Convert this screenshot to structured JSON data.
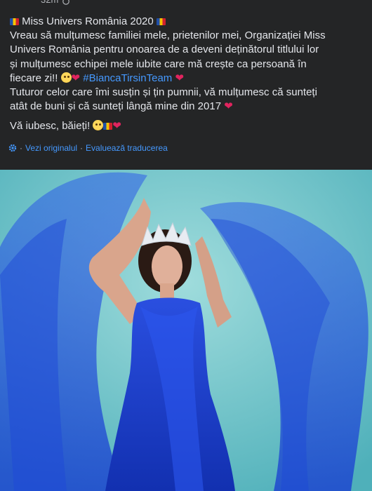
{
  "header": {
    "time": "32m"
  },
  "post": {
    "title": "Miss Univers România 2020",
    "line1": "Vreau să mulțumesc familiei mele, prietenilor mei, Organizației Miss",
    "line2": "Univers România pentru onoarea de a deveni deținătorul titlului lor",
    "line3": "și mulțumesc echipei mele iubite care mă crește ca persoană în",
    "line4_text": "fiecare zi!!",
    "hashtag": "#BiancaTirsinTeam",
    "line5": "Tuturor celor care îmi susțin și țin pumnii, vă mulțumesc că sunteți",
    "line6": "atât de buni și că sunteți lângă mine din 2017",
    "line7": "Vă iubesc, băieți!"
  },
  "translation": {
    "original_link": "Vezi originalul",
    "separator": "·",
    "rate_link": "Evaluează traducerea"
  },
  "icons": {
    "flag": "romania-flag-icon",
    "heart": "red-heart-icon",
    "face": "pleading-face-icon",
    "gear": "gear-icon",
    "globe": "globe-icon"
  },
  "colors": {
    "background": "#242526",
    "text": "#e4e6eb",
    "link": "#4599ff",
    "heart": "#e0245e",
    "photo_backdrop": "#6fc6cc",
    "dress": "#1a3fd0"
  }
}
